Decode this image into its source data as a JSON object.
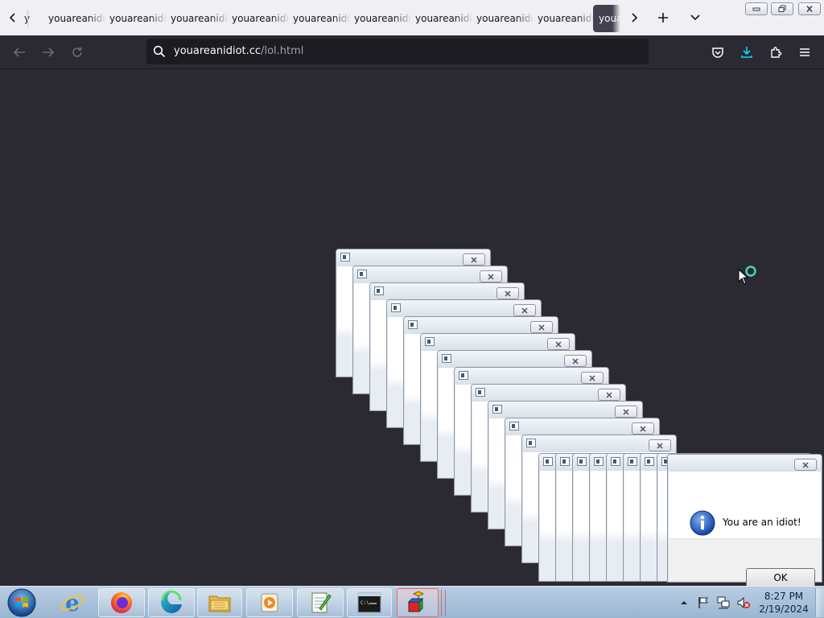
{
  "browser": {
    "tabs": [
      {
        "label": "youareanidiot.cc",
        "active": false
      },
      {
        "label": "youareanidiot.cc",
        "active": false
      },
      {
        "label": "youareanidiot.cc",
        "active": false
      },
      {
        "label": "youareanidiot.cc",
        "active": false
      },
      {
        "label": "youareanidiot.cc",
        "active": false
      },
      {
        "label": "youareanidiot.cc",
        "active": false
      },
      {
        "label": "youareanidiot.cc",
        "active": false
      },
      {
        "label": "youareanidiot.cc",
        "active": false
      },
      {
        "label": "youareanidiot.cc",
        "active": false
      },
      {
        "label": "youareanidiot.cc",
        "active": true
      }
    ],
    "partial_tab_label": "youareanidiot.cc",
    "url_host": "youareanidiot.cc",
    "url_path": "/lol.html",
    "theme": {
      "toolbar": "#2b2a33",
      "urlbar": "#1c1b22",
      "tabstrip": "#f0f0f4",
      "accent": "#0df"
    }
  },
  "dialog": {
    "message": "You are an idiot!",
    "ok_label": "OK",
    "stacked_popup_count": 20
  },
  "taskbar": {
    "apps": [
      "start-orb",
      "internet-explorer",
      "firefox",
      "edge",
      "file-explorer",
      "media-player",
      "notepad",
      "command-prompt",
      "paint-3d-shapes"
    ],
    "time": "8:27 PM",
    "date": "2/19/2024"
  }
}
